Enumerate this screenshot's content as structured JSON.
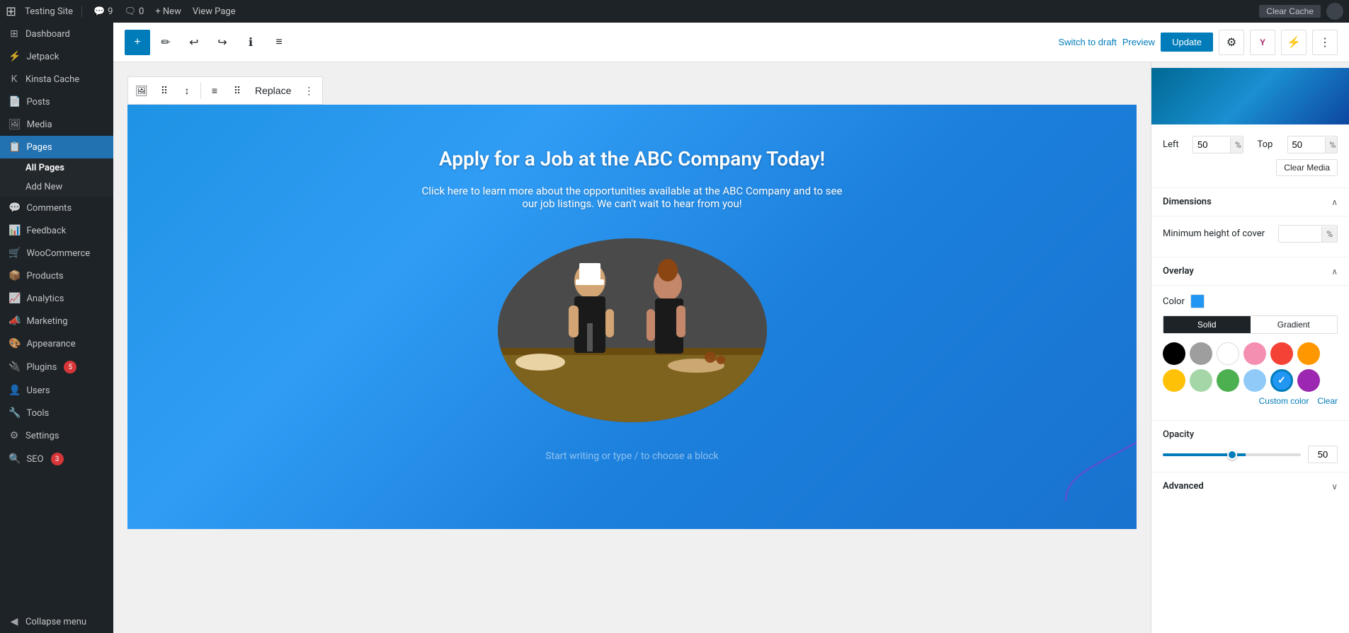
{
  "adminBar": {
    "siteName": "Testing Site",
    "commentCount": "9",
    "commentIcon": "💬",
    "newLabel": "+ New",
    "viewPageLabel": "View Page",
    "clearCacheLabel": "Clear Cache"
  },
  "sidebar": {
    "items": [
      {
        "id": "dashboard",
        "label": "Dashboard",
        "icon": "⊞"
      },
      {
        "id": "jetpack",
        "label": "Jetpack",
        "icon": "⚡"
      },
      {
        "id": "kinsta",
        "label": "Kinsta Cache",
        "icon": "K"
      },
      {
        "id": "posts",
        "label": "Posts",
        "icon": "📄"
      },
      {
        "id": "media",
        "label": "Media",
        "icon": "🖼"
      },
      {
        "id": "pages",
        "label": "Pages",
        "icon": "📋",
        "active": true
      },
      {
        "id": "all-pages",
        "label": "All Pages",
        "sub": true,
        "active": true
      },
      {
        "id": "add-new",
        "label": "Add New",
        "sub": true
      },
      {
        "id": "comments",
        "label": "Comments",
        "icon": "💬"
      },
      {
        "id": "feedback",
        "label": "Feedback",
        "icon": "📊"
      },
      {
        "id": "woocommerce",
        "label": "WooCommerce",
        "icon": "🛒"
      },
      {
        "id": "products",
        "label": "Products",
        "icon": "📦"
      },
      {
        "id": "analytics",
        "label": "Analytics",
        "icon": "📈"
      },
      {
        "id": "marketing",
        "label": "Marketing",
        "icon": "📣"
      },
      {
        "id": "appearance",
        "label": "Appearance",
        "icon": "🎨"
      },
      {
        "id": "plugins",
        "label": "Plugins",
        "icon": "🔌",
        "badge": "5"
      },
      {
        "id": "users",
        "label": "Users",
        "icon": "👤"
      },
      {
        "id": "tools",
        "label": "Tools",
        "icon": "🔧"
      },
      {
        "id": "settings",
        "label": "Settings",
        "icon": "⚙"
      },
      {
        "id": "seo",
        "label": "SEO",
        "icon": "🔍",
        "badge": "3"
      }
    ],
    "collapseLabel": "Collapse menu"
  },
  "toolbar": {
    "addBlockLabel": "+",
    "switchDraftLabel": "Switch to draft",
    "previewLabel": "Preview",
    "updateLabel": "Update"
  },
  "blockToolbar": {
    "tools": [
      "🖼",
      "⠿",
      "↕",
      "≡",
      "⠿",
      "Replace",
      "⋮"
    ]
  },
  "cover": {
    "title": "Apply for a Job at the ABC Company Today!",
    "subtitle": "Click here to learn more about the opportunities available at the ABC Company and to see our job listings. We can't wait to hear from you!",
    "placeholder": "Start writing or type / to choose a block"
  },
  "rightPanel": {
    "positionLeft": "50",
    "positionTop": "50",
    "leftLabel": "Left",
    "topLabel": "Top",
    "percentSign": "%",
    "clearMediaLabel": "Clear Media",
    "dimensions": {
      "title": "Dimensions",
      "minHeightLabel": "Minimum height of cover",
      "minHeightValue": "",
      "minHeightUnit": "%"
    },
    "overlay": {
      "title": "Overlay",
      "colorLabel": "Color",
      "colorHex": "#2196F3",
      "solidLabel": "Solid",
      "gradientLabel": "Gradient",
      "colors": [
        {
          "id": "black",
          "hex": "#000000",
          "selected": false
        },
        {
          "id": "gray",
          "hex": "#9e9e9e",
          "selected": false
        },
        {
          "id": "white",
          "hex": "#ffffff",
          "selected": false
        },
        {
          "id": "pink",
          "hex": "#f48fb1",
          "selected": false
        },
        {
          "id": "red",
          "hex": "#f44336",
          "selected": false
        },
        {
          "id": "orange",
          "hex": "#ff9800",
          "selected": false
        },
        {
          "id": "yellow",
          "hex": "#ffc107",
          "selected": false
        },
        {
          "id": "lightgreen",
          "hex": "#a5d6a7",
          "selected": false
        },
        {
          "id": "green",
          "hex": "#4caf50",
          "selected": false
        },
        {
          "id": "lightblue",
          "hex": "#90caf9",
          "selected": false
        },
        {
          "id": "blue",
          "hex": "#2196F3",
          "selected": true
        },
        {
          "id": "purple",
          "hex": "#9c27b0",
          "selected": false
        }
      ],
      "customColorLabel": "Custom color",
      "clearLabel": "Clear"
    },
    "opacity": {
      "title": "Opacity",
      "value": "50"
    },
    "advanced": {
      "title": "Advanced"
    }
  }
}
